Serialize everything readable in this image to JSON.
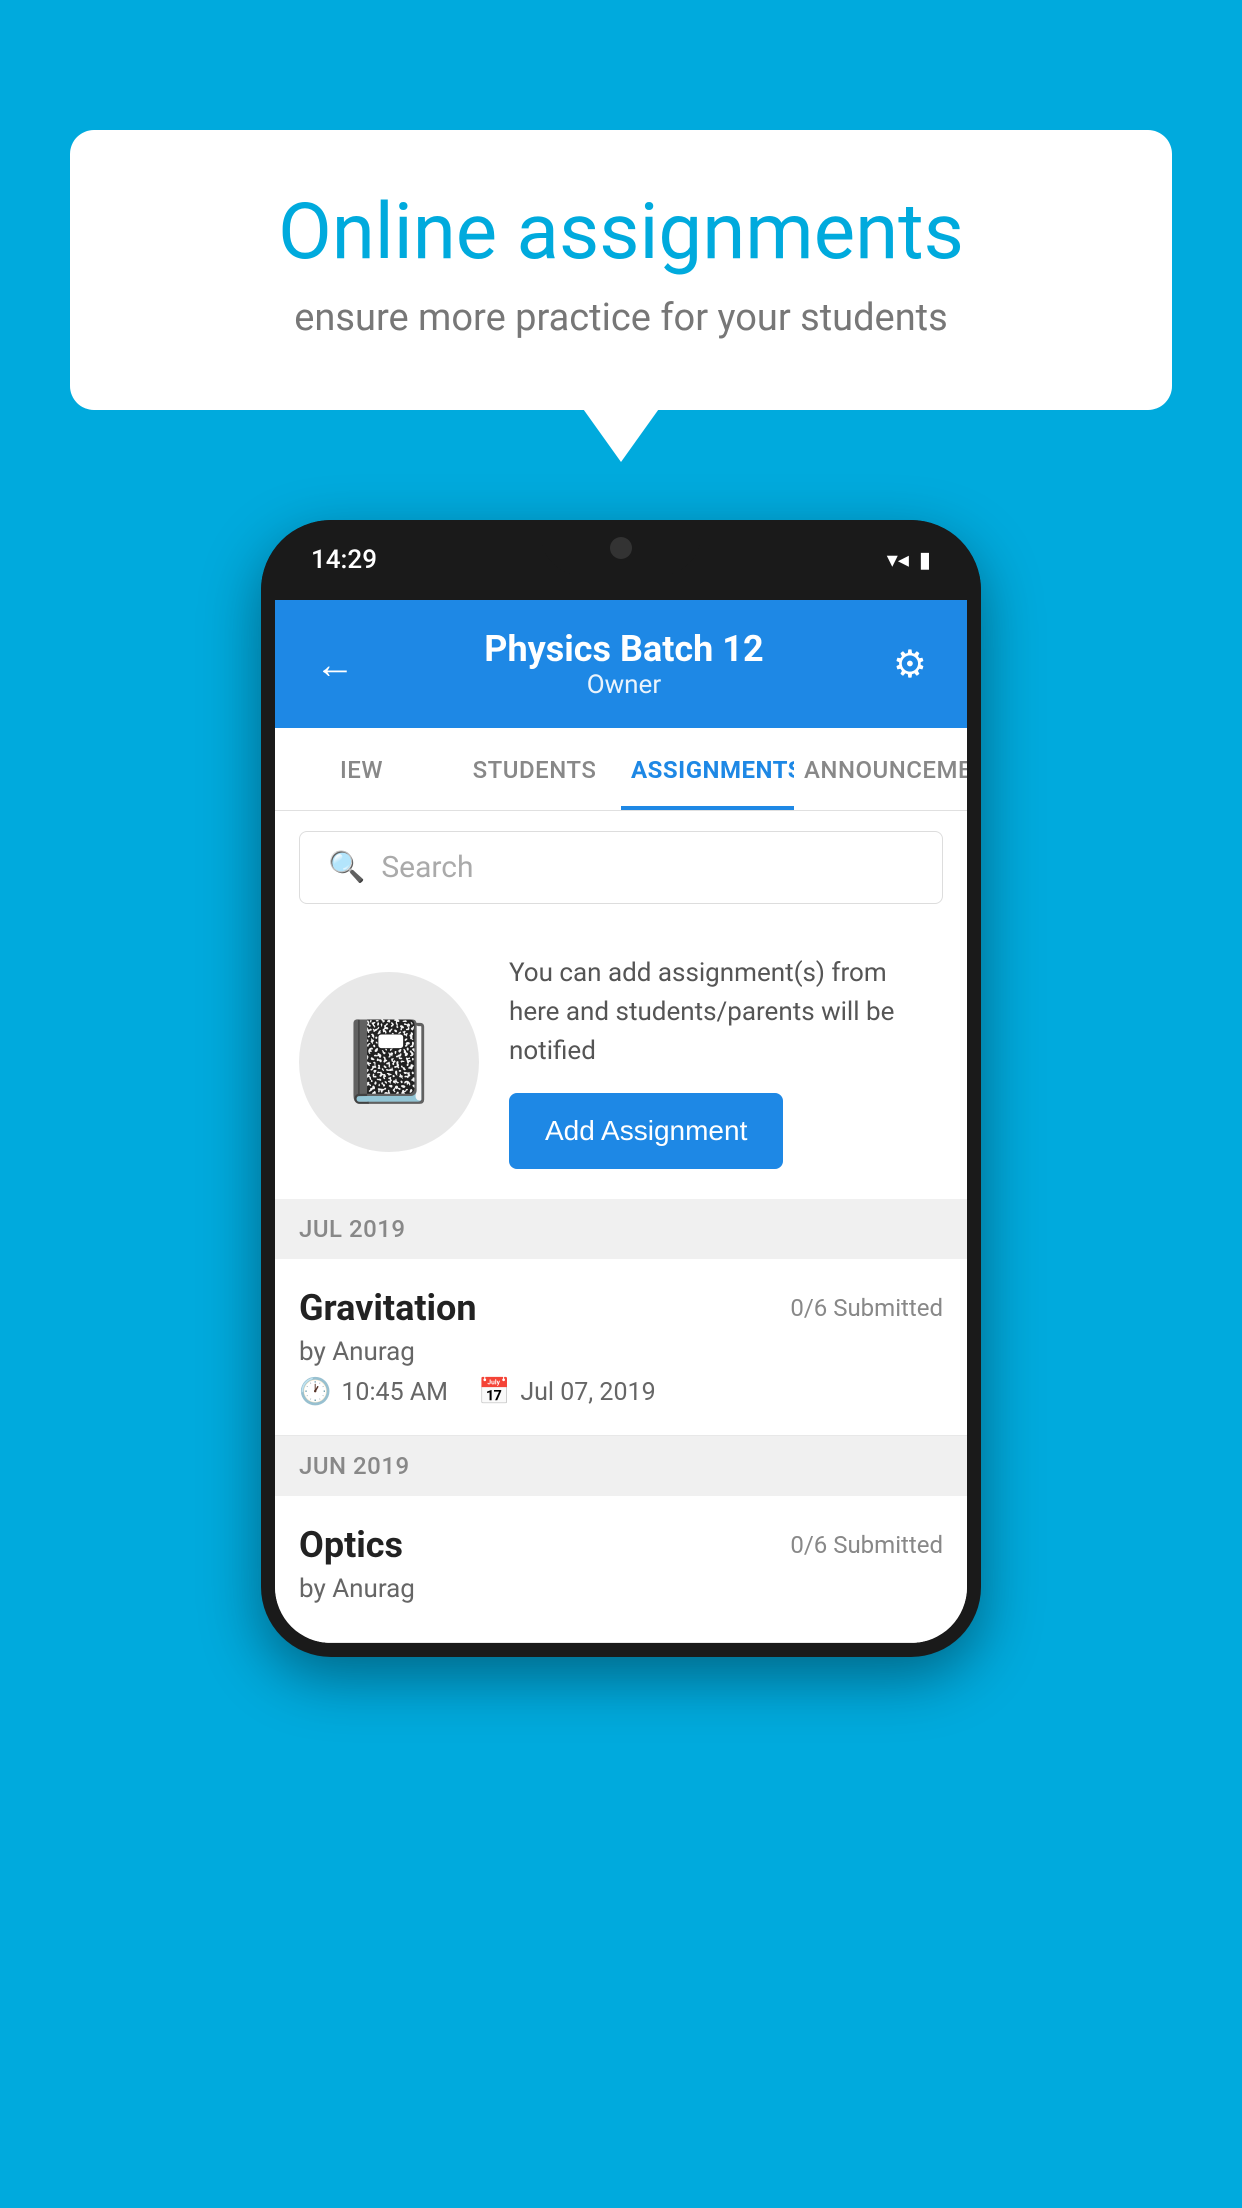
{
  "background_color": "#00AADD",
  "speech_bubble": {
    "title": "Online assignments",
    "subtitle": "ensure more practice for your students"
  },
  "phone": {
    "status_bar": {
      "time": "14:29",
      "wifi_icon": "▼",
      "signal_icon": "◀",
      "battery_icon": "▮"
    },
    "header": {
      "back_icon": "←",
      "title": "Physics Batch 12",
      "subtitle": "Owner",
      "gear_icon": "⚙"
    },
    "tabs": [
      {
        "label": "IEW",
        "active": false
      },
      {
        "label": "STUDENTS",
        "active": false
      },
      {
        "label": "ASSIGNMENTS",
        "active": true
      },
      {
        "label": "ANNOUNCEME",
        "active": false
      }
    ],
    "search": {
      "placeholder": "Search"
    },
    "info_card": {
      "description": "You can add assignment(s) from here and students/parents will be notified",
      "button_label": "Add Assignment"
    },
    "sections": [
      {
        "month_label": "JUL 2019",
        "assignments": [
          {
            "name": "Gravitation",
            "submitted": "0/6 Submitted",
            "by": "by Anurag",
            "time": "10:45 AM",
            "date": "Jul 07, 2019"
          }
        ]
      },
      {
        "month_label": "JUN 2019",
        "assignments": [
          {
            "name": "Optics",
            "submitted": "0/6 Submitted",
            "by": "by Anurag",
            "time": "",
            "date": ""
          }
        ]
      }
    ]
  }
}
